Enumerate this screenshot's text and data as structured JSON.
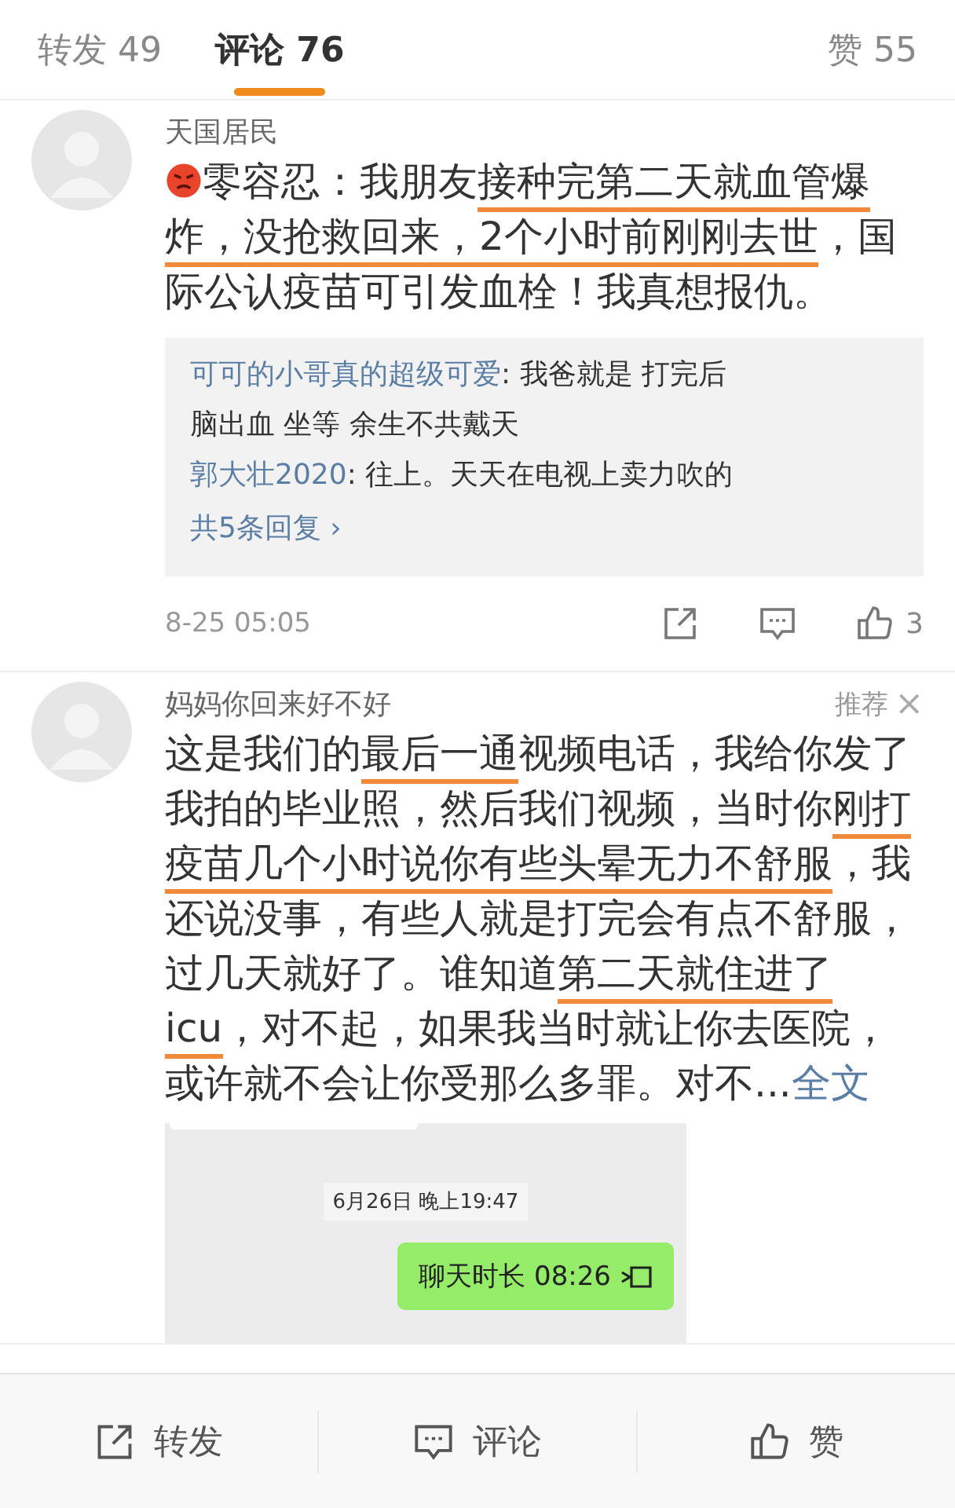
{
  "tabs": [
    {
      "label": "转发 49",
      "selected": false
    },
    {
      "label": "评论 76",
      "selected": true
    },
    {
      "label": "赞 55",
      "selected": false
    }
  ],
  "comments": [
    {
      "author": "天国居民",
      "segments": [
        {
          "kind": "emoji"
        },
        {
          "kind": "text",
          "text": "零容忍：我朋友",
          "underlined": false
        },
        {
          "kind": "text",
          "text": "接种完第二天就血管爆炸，没抢救回来，2个小时前刚刚去世",
          "underlined": true
        },
        {
          "kind": "text",
          "text": "，国际公认疫苗可引发血栓！我真想报仇。",
          "underlined": false
        }
      ],
      "replies": [
        {
          "author": "可可的小哥真的超级可爱",
          "text": ": 我爸就是 打完后脑出血 坐等 余生不共戴天"
        },
        {
          "author": "郭大壮2020",
          "text": ": 往上。天天在电视上卖力吹的"
        }
      ],
      "reply_more": "共5条回复 ›",
      "time": "8-25 05:05",
      "like_count": "3"
    },
    {
      "author": "妈妈你回来好不好",
      "tag": "推荐",
      "close": "×",
      "segments": [
        {
          "kind": "text",
          "text": "这是我们的",
          "underlined": false
        },
        {
          "kind": "text",
          "text": "最后一通",
          "underlined": true
        },
        {
          "kind": "text",
          "text": "视频电话，我给你发了我拍的毕业照，然后我们视频，当时你",
          "underlined": false
        },
        {
          "kind": "text",
          "text": "刚打疫苗几个小时说你有些头晕无力不舒服",
          "underlined": true
        },
        {
          "kind": "text",
          "text": "，我还说没事，有些人就是打完会有点不舒服，过几天就好了。谁知道",
          "underlined": false
        },
        {
          "kind": "text",
          "text": "第二天就住进了icu",
          "underlined": true
        },
        {
          "kind": "text",
          "text": "，对不起，如果我当时就让你去医院，或许就不会让你受那么多罪。对不...",
          "underlined": false
        }
      ],
      "expand_link": "全文",
      "attachment": {
        "date": "6月26日 晚上19:47",
        "call": "聊天时长 08:26"
      }
    }
  ],
  "bottom_bar": [
    {
      "label": "转发"
    },
    {
      "label": "评论"
    },
    {
      "label": "赞"
    }
  ]
}
